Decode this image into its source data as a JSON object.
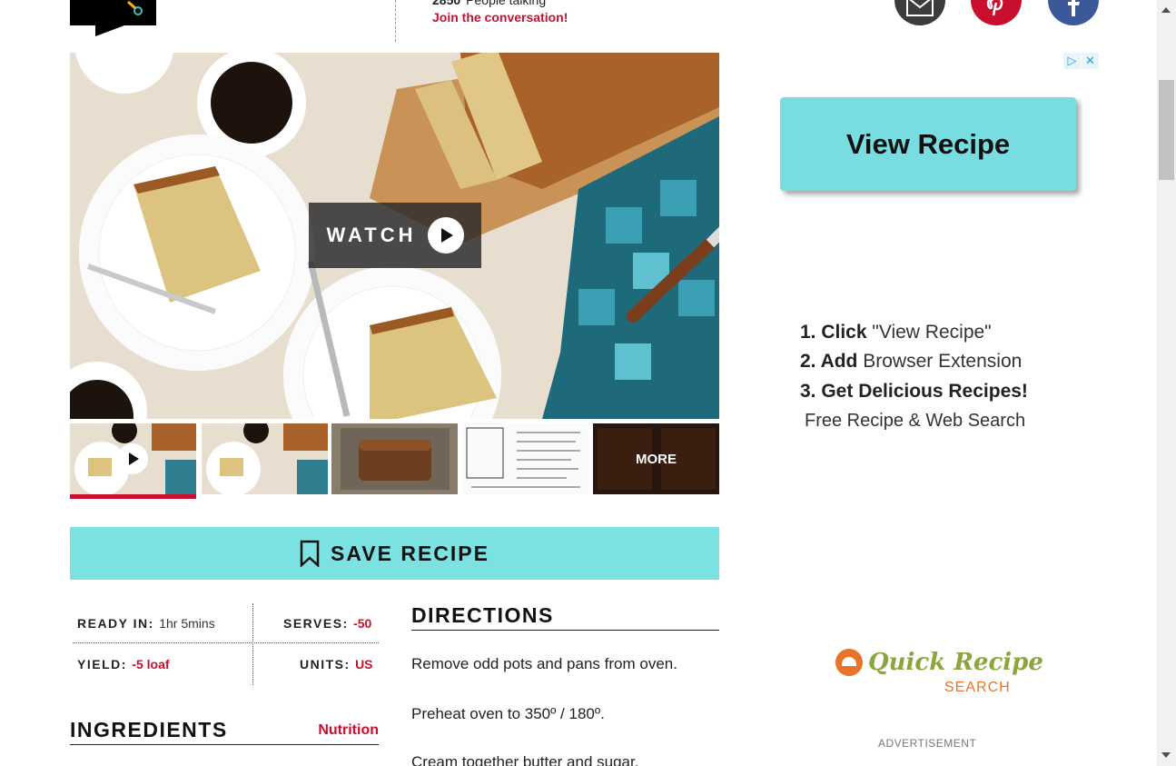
{
  "header": {
    "talk_count": "2850",
    "talk_label": "People talking",
    "join_link": "Join the conversation!"
  },
  "social": [
    "email-icon",
    "pinterest-icon",
    "facebook-icon"
  ],
  "hero": {
    "watch_label": "WATCH"
  },
  "thumbnails": {
    "more_label": "MORE"
  },
  "save_recipe": {
    "label": "SAVE RECIPE"
  },
  "info": {
    "ready_in_label": "READY IN",
    "ready_in_value": "1hr 5mins",
    "serves_label": "SERVES",
    "serves_value": "-50",
    "yield_label": "YIELD",
    "yield_value": "-5 loaf",
    "units_label": "UNITS",
    "units_value": "US"
  },
  "ingredients": {
    "title": "INGREDIENTS",
    "nutrition_link": "Nutrition"
  },
  "directions": {
    "title": "DIRECTIONS",
    "steps": [
      "Remove odd pots and pans from oven.",
      "Preheat oven to 350º / 180º.",
      "Cream together butter and sugar."
    ]
  },
  "ad": {
    "button": "View Recipe",
    "step1_bold": "1. Click",
    "step1_rest": " \"View Recipe\"",
    "step2_bold": "2. Add",
    "step2_rest": " Browser Extension",
    "step3_bold": "3. Get Delicious Recipes!",
    "free_line": "Free Recipe & Web Search",
    "logo_title": "Quick Recipe",
    "logo_sub": "SEARCH",
    "label": "ADVERTISEMENT"
  },
  "colors": {
    "accent_red": "#c8102e",
    "save_bar": "#7be1e1",
    "ad_button": "#77dde1"
  }
}
